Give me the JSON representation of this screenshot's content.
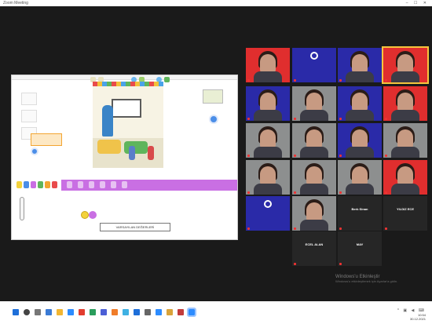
{
  "window": {
    "title": "Zoom Meeting",
    "controls": "– ☐ ✕"
  },
  "shared_app": {
    "window_title": "",
    "script_text": "VARSAYILAN DEĞERLERİ"
  },
  "participants": [
    {
      "label": "",
      "bg": "red",
      "kind": "face"
    },
    {
      "label": "",
      "bg": "blue",
      "kind": "logo"
    },
    {
      "label": "",
      "bg": "blue",
      "kind": "face"
    },
    {
      "label": "",
      "bg": "red",
      "kind": "face",
      "active": true
    },
    {
      "label": "",
      "bg": "blue",
      "kind": "face"
    },
    {
      "label": "",
      "bg": "grey",
      "kind": "face"
    },
    {
      "label": "",
      "bg": "blue",
      "kind": "face"
    },
    {
      "label": "",
      "bg": "red",
      "kind": "face"
    },
    {
      "label": "",
      "bg": "grey",
      "kind": "face"
    },
    {
      "label": "",
      "bg": "grey",
      "kind": "face"
    },
    {
      "label": "",
      "bg": "blue",
      "kind": "face"
    },
    {
      "label": "",
      "bg": "grey",
      "kind": "face"
    },
    {
      "label": "",
      "bg": "grey",
      "kind": "face"
    },
    {
      "label": "",
      "bg": "grey",
      "kind": "face"
    },
    {
      "label": "",
      "bg": "grey",
      "kind": "face"
    },
    {
      "label": "",
      "bg": "red",
      "kind": "face"
    },
    {
      "label": "",
      "bg": "blue",
      "kind": "logo"
    },
    {
      "label": "",
      "bg": "grey",
      "kind": "face"
    },
    {
      "label": "Berk Sinan",
      "bg": "dark",
      "kind": "name"
    },
    {
      "label": "YILDIZ ECE",
      "bg": "dark",
      "kind": "name"
    },
    {
      "label": "",
      "bg": "none",
      "kind": "empty"
    },
    {
      "label": "ECEL ALAN",
      "bg": "dark",
      "kind": "name"
    },
    {
      "label": "MAY",
      "bg": "dark",
      "kind": "name"
    }
  ],
  "watermark": {
    "line1": "Windows'u Etkinleştir",
    "line2": "Windows'u etkinleştirmek için Ayarlar'a gidin."
  },
  "taskbar": {
    "tray_icons": "^ ▣ ◀ ⌨",
    "time": "10:54",
    "date": "30.12.2021"
  },
  "colors": {
    "red": "#e02e2e",
    "blue": "#2a2aa8",
    "grey": "#8d8f8f",
    "dark": "#262626",
    "active_outline": "#f5c53d",
    "scratch_purple": "#c96fe3"
  }
}
